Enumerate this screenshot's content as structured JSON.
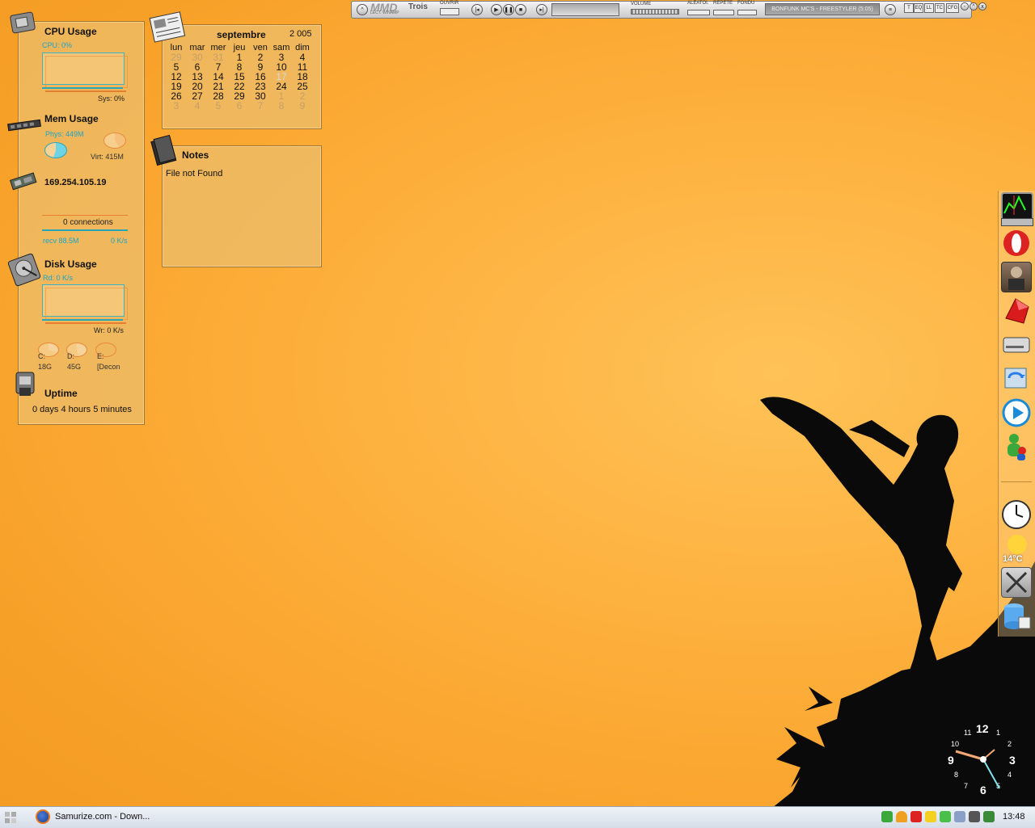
{
  "cpu": {
    "title": "CPU Usage",
    "cpu_label": "CPU: 0%",
    "sys_label": "Sys: 0%"
  },
  "mem": {
    "title": "Mem Usage",
    "phys_label": "Phys: 449M",
    "virt_label": "Virt: 415M"
  },
  "net": {
    "ip": "169.254.105.19",
    "connections": "0 connections",
    "recv": "recv 88.5M",
    "rate": "0 K/s"
  },
  "disk": {
    "title": "Disk Usage",
    "read": "Rd: 0 K/s",
    "write": "Wr: 0 K/s",
    "drives": [
      {
        "letter": "C:",
        "size": "18G"
      },
      {
        "letter": "D:",
        "size": "45G"
      },
      {
        "letter": "E:",
        "size": "[Decon"
      }
    ]
  },
  "uptime": {
    "title": "Uptime",
    "value": "0 days 4 hours 5 minutes"
  },
  "calendar": {
    "month": "septembre",
    "year": "2 005",
    "days": [
      "lun",
      "mar",
      "mer",
      "jeu",
      "ven",
      "sam",
      "dim"
    ],
    "weeks": [
      [
        "29",
        "30",
        "31",
        "1",
        "2",
        "3",
        "4"
      ],
      [
        "5",
        "6",
        "7",
        "8",
        "9",
        "10",
        "11"
      ],
      [
        "12",
        "13",
        "14",
        "15",
        "16",
        "17",
        "18"
      ],
      [
        "19",
        "20",
        "21",
        "22",
        "23",
        "24",
        "25"
      ],
      [
        "26",
        "27",
        "28",
        "29",
        "30",
        "1",
        "2"
      ],
      [
        "3",
        "4",
        "5",
        "6",
        "7",
        "8",
        "9"
      ]
    ],
    "today": "17"
  },
  "notes": {
    "title": "Notes",
    "body": "File not Found"
  },
  "player": {
    "logo": "MMD",
    "logo2": "Trois",
    "sub": "LECT. WINAMP",
    "open": "OUVRIR",
    "volume": "VOLUME",
    "shuffle": "ALÉATOI.",
    "repeat": "RÉPÈTE",
    "fade": "FONDU",
    "track": "BONFUNK MC'S - FREESTYLER (5:05)",
    "btns": [
      "T",
      "EQ",
      "LL",
      "TC",
      "CFG"
    ]
  },
  "clock": {
    "numbers": [
      "12",
      "1",
      "2",
      "3",
      "4",
      "5",
      "6",
      "7",
      "8",
      "9",
      "10",
      "11"
    ]
  },
  "weather": {
    "temp": "14°C"
  },
  "taskbar": {
    "task": "Samurize.com - Down...",
    "time": "13:48"
  },
  "colors": {
    "accent_cyan": "#1aa5c8",
    "accent_orange": "#e67f2e",
    "background": "#fdae3a"
  }
}
